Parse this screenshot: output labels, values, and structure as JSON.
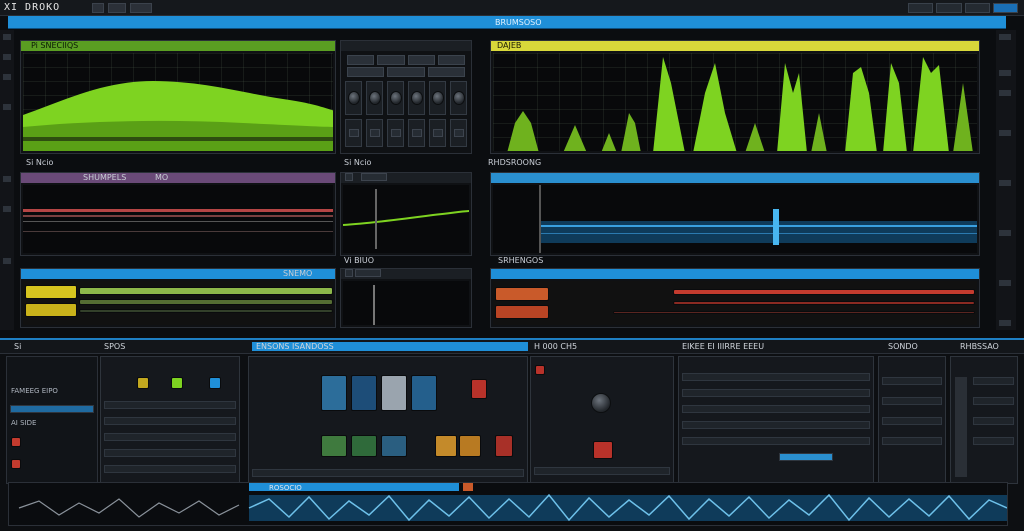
{
  "app": {
    "title": "XI DROKO"
  },
  "strip": {
    "label": "BRUMSOSO"
  },
  "panels": {
    "p1": {
      "title": "Pi SNECIIQS"
    },
    "p2": {
      "title": ""
    },
    "p3": {
      "title": "DAJEB"
    },
    "p4": {
      "title": "SHUMPELS",
      "sub": "MO"
    },
    "p5": {
      "title": "Si Ncio"
    },
    "p6": {
      "title": "RHDSROONG"
    },
    "p7": {
      "title": "SNEMO"
    },
    "p8": {
      "title": ""
    },
    "p9": {
      "title": "Vi BIUO"
    },
    "p10": {
      "title": "SRHENGOS"
    }
  },
  "mixer": {
    "rail": [
      "Si",
      "SPOS",
      "ENSONS ISANDOSS",
      "H 000 CH5",
      "EIKEE EI IIIRRE EEEU",
      "SONDO",
      "RHBSSAO"
    ],
    "modules": {
      "m1_label": "FAMEEG EIPO",
      "m1_sub": "AI SIDE"
    },
    "wave_label": "ROSOCIO"
  },
  "colors": {
    "accent_blue": "#1f8fd8",
    "wave_green": "#7ed321",
    "wave_yellow": "#e4e43a",
    "purple_header": "#6a4a78",
    "red_track": "#c33b2e"
  }
}
